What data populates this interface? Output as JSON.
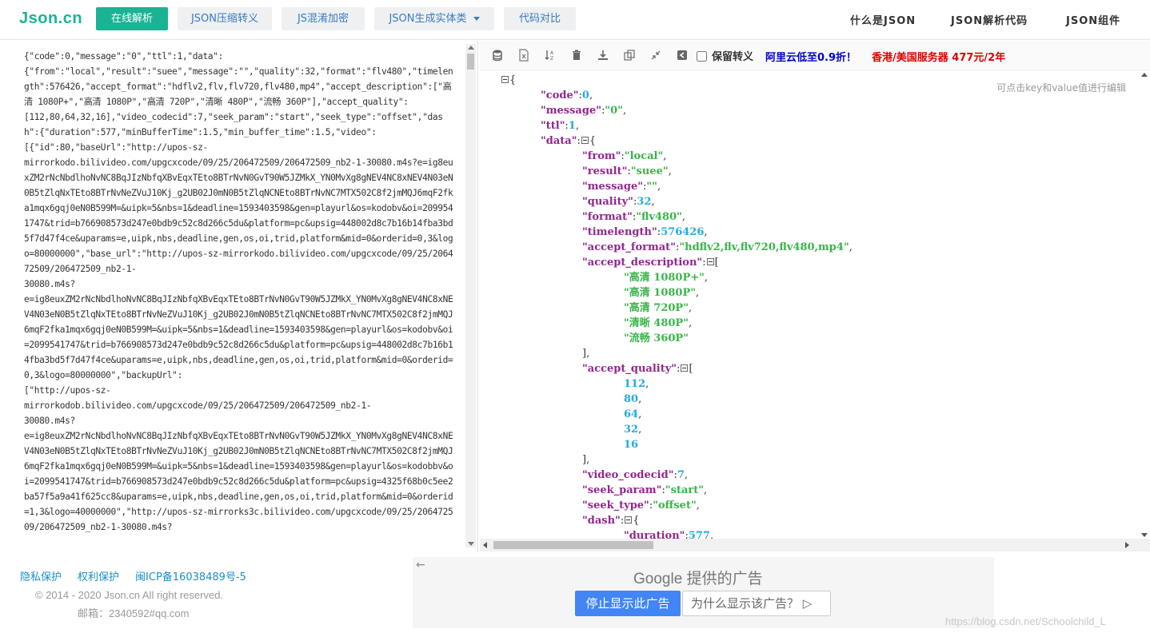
{
  "header": {
    "logo": "Json.cn",
    "nav": [
      {
        "label": "在线解析"
      },
      {
        "label": "JSON压缩转义"
      },
      {
        "label": "JS混淆加密"
      },
      {
        "label": "JSON生成实体类"
      },
      {
        "label": "代码对比"
      }
    ],
    "right_links": [
      "什么是JSON",
      "JSON解析代码",
      "JSON组件"
    ]
  },
  "editor": {
    "raw_text": "{\"code\":0,\"message\":\"0\",\"ttl\":1,\"data\":\n{\"from\":\"local\",\"result\":\"suee\",\"message\":\"\",\"quality\":32,\"format\":\"flv480\",\"timelength\":576426,\"accept_format\":\"hdflv2,flv,flv720,flv480,mp4\",\"accept_description\":[\"高清 1080P+\",\"高清 1080P\",\"高清 720P\",\"清晰 480P\",\"流畅 360P\"],\"accept_quality\":\n[112,80,64,32,16],\"video_codecid\":7,\"seek_param\":\"start\",\"seek_type\":\"offset\",\"dash\":{\"duration\":577,\"minBufferTime\":1.5,\"min_buffer_time\":1.5,\"video\":\n[{\"id\":80,\"baseUrl\":\"http://upos-sz-\nmirrorkodo.bilivideo.com/upgcxcode/09/25/206472509/206472509_nb2-1-30080.m4s?e=ig8euxZM2rNcNbdlhoNvNC8BqJIzNbfqXBvEqxTEto8BTrNvN0GvT90W5JZMkX_YN0MvXg8gNEV4NC8xNEV4N03eN0B5tZlqNxTEto8BTrNvNeZVuJ10Kj_g2UB02J0mN0B5tZlqNCNEto8BTrNvNC7MTX502C8f2jmMQJ6mqF2fka1mqx6gqj0eN0B599M=&uipk=5&nbs=1&deadline=1593403598&gen=playurl&os=kodobv&oi=2099541747&trid=b766908573d247e0bdb9c52c8d266c5du&platform=pc&upsig=448002d8c7b16b14fba3bd5f7d47f4ce&uparams=e,uipk,nbs,deadline,gen,os,oi,trid,platform&mid=0&orderid=0,3&logo=80000000\",\"base_url\":\"http://upos-sz-mirrorkodo.bilivideo.com/upgcxcode/09/25/206472509/206472509_nb2-1-\n30080.m4s?\ne=ig8euxZM2rNcNbdlhoNvNC8BqJIzNbfqXBvEqxTEto8BTrNvN0GvT90W5JZMkX_YN0MvXg8gNEV4NC8xNEV4N03eN0B5tZlqNxTEto8BTrNvNeZVuJ10Kj_g2UB02J0mN0B5tZlqNCNEto8BTrNvNC7MTX502C8f2jmMQJ6mqF2fka1mqx6gqj0eN0B599M=&uipk=5&nbs=1&deadline=1593403598&gen=playurl&os=kodobv&oi=2099541747&trid=b766908573d247e0bdb9c52c8d266c5du&platform=pc&upsig=448002d8c7b16b14fba3bd5f7d47f4ce&uparams=e,uipk,nbs,deadline,gen,os,oi,trid,platform&mid=0&orderid=0,3&logo=80000000\",\"backupUrl\":\n[\"http://upos-sz-\nmirrorkodob.bilivideo.com/upgcxcode/09/25/206472509/206472509_nb2-1-\n30080.m4s?\ne=ig8euxZM2rNcNbdlhoNvNC8BqJIzNbfqXBvEqxTEto8BTrNvN0GvT90W5JZMkX_YN0MvXg8gNEV4NC8xNEV4N03eN0B5tZlqNxTEto8BTrNvNeZVuJ10Kj_g2UB02J0mN0B5tZlqNCNEto8BTrNvNC7MTX502C8f2jmMQJ6mqF2fka1mqx6gqj0eN0B599M=&uipk=5&nbs=1&deadline=1593403598&gen=playurl&os=kodobbv&oi=2099541747&trid=b766908573d247e0bdb9c52c8d266c5du&platform=pc&upsig=4325f68b0c5ee2ba57f5a9a41f625cc8&uparams=e,uipk,nbs,deadline,gen,os,oi,trid,platform&mid=0&orderid=1,3&logo=40000000\",\"http://upos-sz-mirrorks3c.bilivideo.com/upgcxcode/09/25/206472509/206472509_nb2-1-30080.m4s?"
  },
  "toolbar": {
    "icons": [
      "database-icon",
      "excel-icon",
      "sort-icon",
      "trash-icon",
      "download-icon",
      "copy-icon",
      "compress-icon",
      "back-icon"
    ],
    "keep_escape_label": "保留转义",
    "ad1": "阿里云低至0.9折！",
    "ad2": "香港/美国服务器 477元/2年"
  },
  "tree": {
    "hint": "可点击key和value值进行编辑",
    "lines": [
      {
        "indent": 0,
        "toggle": true,
        "parts": [
          [
            "p",
            "{"
          ]
        ]
      },
      {
        "indent": 1,
        "parts": [
          [
            "k",
            "\"code\""
          ],
          [
            "p",
            ":"
          ],
          [
            "n",
            "0"
          ],
          [
            "p",
            ","
          ]
        ]
      },
      {
        "indent": 1,
        "parts": [
          [
            "k",
            "\"message\""
          ],
          [
            "p",
            ":"
          ],
          [
            "s",
            "\"0\""
          ],
          [
            "p",
            ","
          ]
        ]
      },
      {
        "indent": 1,
        "parts": [
          [
            "k",
            "\"ttl\""
          ],
          [
            "p",
            ":"
          ],
          [
            "n",
            "1"
          ],
          [
            "p",
            ","
          ]
        ]
      },
      {
        "indent": 1,
        "parts": [
          [
            "k",
            "\"data\""
          ],
          [
            "p",
            ":"
          ],
          [
            "t",
            ""
          ],
          [
            "p",
            "{"
          ]
        ]
      },
      {
        "indent": 2,
        "parts": [
          [
            "k",
            "\"from\""
          ],
          [
            "p",
            ":"
          ],
          [
            "s",
            "\"local\""
          ],
          [
            "p",
            ","
          ]
        ]
      },
      {
        "indent": 2,
        "parts": [
          [
            "k",
            "\"result\""
          ],
          [
            "p",
            ":"
          ],
          [
            "s",
            "\"suee\""
          ],
          [
            "p",
            ","
          ]
        ]
      },
      {
        "indent": 2,
        "parts": [
          [
            "k",
            "\"message\""
          ],
          [
            "p",
            ":"
          ],
          [
            "s",
            "\"\""
          ],
          [
            "p",
            ","
          ]
        ]
      },
      {
        "indent": 2,
        "parts": [
          [
            "k",
            "\"quality\""
          ],
          [
            "p",
            ":"
          ],
          [
            "n",
            "32"
          ],
          [
            "p",
            ","
          ]
        ]
      },
      {
        "indent": 2,
        "parts": [
          [
            "k",
            "\"format\""
          ],
          [
            "p",
            ":"
          ],
          [
            "s",
            "\"flv480\""
          ],
          [
            "p",
            ","
          ]
        ]
      },
      {
        "indent": 2,
        "parts": [
          [
            "k",
            "\"timelength\""
          ],
          [
            "p",
            ":"
          ],
          [
            "n",
            "576426"
          ],
          [
            "p",
            ","
          ]
        ]
      },
      {
        "indent": 2,
        "parts": [
          [
            "k",
            "\"accept_format\""
          ],
          [
            "p",
            ":"
          ],
          [
            "s",
            "\"hdflv2,flv,flv720,flv480,mp4\""
          ],
          [
            "p",
            ","
          ]
        ]
      },
      {
        "indent": 2,
        "parts": [
          [
            "k",
            "\"accept_description\""
          ],
          [
            "p",
            ":"
          ],
          [
            "t",
            ""
          ],
          [
            "p",
            "["
          ]
        ]
      },
      {
        "indent": 3,
        "parts": [
          [
            "s",
            "\"高清 1080P+\""
          ],
          [
            "p",
            ","
          ]
        ]
      },
      {
        "indent": 3,
        "parts": [
          [
            "s",
            "\"高清 1080P\""
          ],
          [
            "p",
            ","
          ]
        ]
      },
      {
        "indent": 3,
        "parts": [
          [
            "s",
            "\"高清 720P\""
          ],
          [
            "p",
            ","
          ]
        ]
      },
      {
        "indent": 3,
        "parts": [
          [
            "s",
            "\"清晰 480P\""
          ],
          [
            "p",
            ","
          ]
        ]
      },
      {
        "indent": 3,
        "parts": [
          [
            "s",
            "\"流畅 360P\""
          ]
        ]
      },
      {
        "indent": 2,
        "parts": [
          [
            "p",
            "],"
          ]
        ]
      },
      {
        "indent": 2,
        "parts": [
          [
            "k",
            "\"accept_quality\""
          ],
          [
            "p",
            ":"
          ],
          [
            "t",
            ""
          ],
          [
            "p",
            "["
          ]
        ]
      },
      {
        "indent": 3,
        "parts": [
          [
            "n",
            "112"
          ],
          [
            "p",
            ","
          ]
        ]
      },
      {
        "indent": 3,
        "parts": [
          [
            "n",
            "80"
          ],
          [
            "p",
            ","
          ]
        ]
      },
      {
        "indent": 3,
        "parts": [
          [
            "n",
            "64"
          ],
          [
            "p",
            ","
          ]
        ]
      },
      {
        "indent": 3,
        "parts": [
          [
            "n",
            "32"
          ],
          [
            "p",
            ","
          ]
        ]
      },
      {
        "indent": 3,
        "parts": [
          [
            "n",
            "16"
          ]
        ]
      },
      {
        "indent": 2,
        "parts": [
          [
            "p",
            "],"
          ]
        ]
      },
      {
        "indent": 2,
        "parts": [
          [
            "k",
            "\"video_codecid\""
          ],
          [
            "p",
            ":"
          ],
          [
            "n",
            "7"
          ],
          [
            "p",
            ","
          ]
        ]
      },
      {
        "indent": 2,
        "parts": [
          [
            "k",
            "\"seek_param\""
          ],
          [
            "p",
            ":"
          ],
          [
            "s",
            "\"start\""
          ],
          [
            "p",
            ","
          ]
        ]
      },
      {
        "indent": 2,
        "parts": [
          [
            "k",
            "\"seek_type\""
          ],
          [
            "p",
            ":"
          ],
          [
            "s",
            "\"offset\""
          ],
          [
            "p",
            ","
          ]
        ]
      },
      {
        "indent": 2,
        "parts": [
          [
            "k",
            "\"dash\""
          ],
          [
            "p",
            ":"
          ],
          [
            "t",
            ""
          ],
          [
            "p",
            "{"
          ]
        ]
      },
      {
        "indent": 3,
        "parts": [
          [
            "k",
            "\"duration\""
          ],
          [
            "p",
            ":"
          ],
          [
            "n",
            "577"
          ],
          [
            "p",
            ","
          ]
        ]
      }
    ]
  },
  "footer": {
    "links": [
      "隐私保护",
      "权利保护",
      "闽ICP备16038489号-5"
    ],
    "copyright": "© 2014 - 2020 Json.cn All right reserved.",
    "email": "邮箱：2340592#qq.com"
  },
  "ad_box": {
    "title_brand": "Google",
    "title_rest": "提供的广告",
    "stop_label": "停止显示此广告",
    "why_label": "为什么显示该广告？"
  },
  "watermark": "https://blog.csdn.net/Schoolchild_L"
}
